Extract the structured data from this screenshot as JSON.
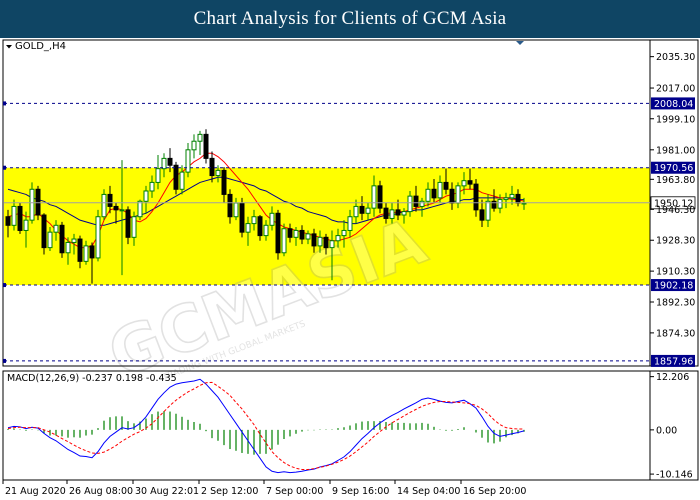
{
  "header": {
    "title": "Chart Analysis for Clients of GCM Asia"
  },
  "chart_data": {
    "type": "candlestick",
    "symbol_label": "GOLD_,H4",
    "watermark": "GCMASIA",
    "watermark_sub": "TRADING WITH GLOBAL MARKETS",
    "y_ticks": [
      "2035.30",
      "2017.00",
      "1999.10",
      "1981.00",
      "1963.80",
      "1946.30",
      "1928.30",
      "1910.30",
      "1892.30",
      "1874.30"
    ],
    "x_ticks": [
      "21 Aug 2020",
      "26 Aug 08:00",
      "30 Aug 22:01",
      "2 Sep 12:00",
      "7 Sep 00:00",
      "9 Sep 16:00",
      "14 Sep 04:00",
      "16 Sep 20:00"
    ],
    "ylim": [
      1855,
      2045
    ],
    "levels": [
      {
        "label": "2008.04",
        "value": 2008.04
      },
      {
        "label": "1970.56",
        "value": 1970.56
      },
      {
        "label": "1902.18",
        "value": 1902.18
      },
      {
        "label": "1857.96",
        "value": 1857.96
      }
    ],
    "current_price": {
      "label": "1950.12",
      "value": 1950.12
    },
    "zone": {
      "upper": 1970.56,
      "lower": 1902.18,
      "color": "#ffff00"
    },
    "colors": {
      "up": "#008000",
      "down": "#000000",
      "ma_fast": "#ff0000",
      "ma_slow": "#00008b",
      "level": "#00008b",
      "macd_line": "#0000ff",
      "macd_signal": "#ff0000",
      "macd_hist": "#008000"
    },
    "ohlc": [
      [
        1942,
        1946,
        1930,
        1937
      ],
      [
        1937,
        1952,
        1934,
        1948
      ],
      [
        1948,
        1950,
        1932,
        1934
      ],
      [
        1934,
        1945,
        1924,
        1940
      ],
      [
        1940,
        1962,
        1938,
        1958
      ],
      [
        1958,
        1960,
        1940,
        1943
      ],
      [
        1943,
        1944,
        1920,
        1924
      ],
      [
        1924,
        1936,
        1922,
        1933
      ],
      [
        1933,
        1940,
        1928,
        1937
      ],
      [
        1937,
        1939,
        1918,
        1921
      ],
      [
        1921,
        1930,
        1914,
        1927
      ],
      [
        1927,
        1932,
        1920,
        1929
      ],
      [
        1929,
        1931,
        1912,
        1916
      ],
      [
        1916,
        1928,
        1914,
        1925
      ],
      [
        1925,
        1927,
        1903,
        1918
      ],
      [
        1918,
        1946,
        1916,
        1942
      ],
      [
        1942,
        1958,
        1940,
        1955
      ],
      [
        1955,
        1960,
        1944,
        1948
      ],
      [
        1948,
        1950,
        1938,
        1946
      ],
      [
        1946,
        1975,
        1908,
        1946
      ],
      [
        1946,
        1948,
        1926,
        1930
      ],
      [
        1930,
        1945,
        1925,
        1942
      ],
      [
        1942,
        1952,
        1940,
        1951
      ],
      [
        1951,
        1960,
        1944,
        1957
      ],
      [
        1957,
        1966,
        1953,
        1962
      ],
      [
        1962,
        1978,
        1958,
        1970
      ],
      [
        1970,
        1979,
        1965,
        1976
      ],
      [
        1976,
        1982,
        1968,
        1972
      ],
      [
        1972,
        1974,
        1955,
        1958
      ],
      [
        1958,
        1972,
        1955,
        1968
      ],
      [
        1968,
        1985,
        1965,
        1981
      ],
      [
        1981,
        1990,
        1976,
        1986
      ],
      [
        1986,
        1992,
        1978,
        1990
      ],
      [
        1990,
        1993,
        1973,
        1976
      ],
      [
        1976,
        1980,
        1962,
        1966
      ],
      [
        1966,
        1972,
        1962,
        1969
      ],
      [
        1969,
        1971,
        1950,
        1955
      ],
      [
        1955,
        1958,
        1938,
        1942
      ],
      [
        1942,
        1953,
        1940,
        1950
      ],
      [
        1950,
        1953,
        1930,
        1933
      ],
      [
        1933,
        1942,
        1925,
        1938
      ],
      [
        1938,
        1946,
        1934,
        1942
      ],
      [
        1942,
        1943,
        1928,
        1931
      ],
      [
        1931,
        1940,
        1928,
        1937
      ],
      [
        1937,
        1948,
        1934,
        1944
      ],
      [
        1944,
        1946,
        1917,
        1921
      ],
      [
        1921,
        1938,
        1919,
        1935
      ],
      [
        1935,
        1938,
        1927,
        1930
      ],
      [
        1930,
        1936,
        1925,
        1934
      ],
      [
        1934,
        1937,
        1926,
        1929
      ],
      [
        1929,
        1934,
        1926,
        1932
      ],
      [
        1932,
        1935,
        1921,
        1925
      ],
      [
        1925,
        1934,
        1921,
        1930
      ],
      [
        1930,
        1932,
        1920,
        1924
      ],
      [
        1924,
        1934,
        1905,
        1928
      ],
      [
        1928,
        1935,
        1924,
        1931
      ],
      [
        1931,
        1940,
        1924,
        1934
      ],
      [
        1934,
        1946,
        1930,
        1942
      ],
      [
        1942,
        1952,
        1938,
        1948
      ],
      [
        1948,
        1954,
        1940,
        1944
      ],
      [
        1944,
        1950,
        1940,
        1947
      ],
      [
        1947,
        1966,
        1942,
        1960
      ],
      [
        1960,
        1963,
        1944,
        1947
      ],
      [
        1947,
        1950,
        1938,
        1941
      ],
      [
        1941,
        1950,
        1938,
        1946
      ],
      [
        1946,
        1952,
        1940,
        1943
      ],
      [
        1943,
        1947,
        1938,
        1945
      ],
      [
        1945,
        1957,
        1942,
        1954
      ],
      [
        1954,
        1960,
        1945,
        1948
      ],
      [
        1948,
        1953,
        1942,
        1951
      ],
      [
        1951,
        1962,
        1948,
        1958
      ],
      [
        1958,
        1964,
        1950,
        1953
      ],
      [
        1953,
        1966,
        1950,
        1962
      ],
      [
        1962,
        1970,
        1955,
        1958
      ],
      [
        1958,
        1962,
        1946,
        1950
      ],
      [
        1950,
        1962,
        1947,
        1960
      ],
      [
        1960,
        1968,
        1955,
        1963
      ],
      [
        1963,
        1970,
        1958,
        1961
      ],
      [
        1961,
        1964,
        1942,
        1946
      ],
      [
        1946,
        1952,
        1936,
        1940
      ],
      [
        1940,
        1955,
        1936,
        1951
      ],
      [
        1951,
        1958,
        1945,
        1947
      ],
      [
        1947,
        1955,
        1944,
        1952
      ],
      [
        1952,
        1956,
        1947,
        1953
      ],
      [
        1953,
        1960,
        1949,
        1955
      ],
      [
        1955,
        1958,
        1948,
        1950
      ],
      [
        1950,
        1953,
        1946,
        1950
      ]
    ],
    "ma_fast": [
      1942,
      1943,
      1944,
      1942,
      1942,
      1944,
      1941,
      1938,
      1934,
      1931,
      1928,
      1926,
      1924,
      1924,
      1925,
      1931,
      1940,
      1946,
      1947,
      1946,
      1944,
      1940,
      1939,
      1941,
      1945,
      1950,
      1956,
      1962,
      1966,
      1968,
      1971,
      1974,
      1976,
      1979,
      1979,
      1977,
      1974,
      1970,
      1966,
      1962,
      1958,
      1953,
      1948,
      1943,
      1940,
      1938,
      1936,
      1935,
      1934,
      1933,
      1932,
      1931,
      1930,
      1929,
      1928,
      1928,
      1929,
      1930,
      1932,
      1935,
      1938,
      1941,
      1943,
      1944,
      1944,
      1945,
      1945,
      1946,
      1947,
      1948,
      1949,
      1950,
      1952,
      1954,
      1955,
      1956,
      1958,
      1958,
      1958,
      1956,
      1955,
      1954,
      1953,
      1953,
      1952,
      1952,
      1951
    ],
    "ma_slow": [
      1958,
      1957,
      1956,
      1955,
      1953,
      1952,
      1951,
      1949,
      1948,
      1946,
      1944,
      1942,
      1940,
      1939,
      1938,
      1937,
      1937,
      1938,
      1939,
      1940,
      1941,
      1942,
      1943,
      1944,
      1946,
      1948,
      1950,
      1952,
      1954,
      1956,
      1958,
      1960,
      1962,
      1963,
      1964,
      1965,
      1965,
      1964,
      1963,
      1962,
      1961,
      1960,
      1958,
      1957,
      1955,
      1953,
      1951,
      1950,
      1948,
      1947,
      1945,
      1944,
      1943,
      1942,
      1940,
      1939,
      1939,
      1938,
      1938,
      1939,
      1940,
      1941,
      1942,
      1943,
      1943,
      1944,
      1945,
      1945,
      1946,
      1946,
      1947,
      1948,
      1949,
      1950,
      1951,
      1951,
      1952,
      1952,
      1953,
      1953,
      1953,
      1953,
      1953,
      1953,
      1953,
      1952,
      1952
    ],
    "macd": {
      "label": "MACD(12,26,9) -0.237 0.198 -0.435",
      "y_ticks": [
        "12.206",
        "0.00",
        "-10.146"
      ],
      "ylim": [
        -11.5,
        13.5
      ],
      "main": [
        0.5,
        0.8,
        0.7,
        0.3,
        0.6,
        0.4,
        -0.8,
        -1.8,
        -2.5,
        -3.5,
        -4.5,
        -5.2,
        -6.0,
        -6.1,
        -6.4,
        -5.0,
        -3.0,
        -1.5,
        -0.5,
        0.5,
        0.2,
        0.5,
        1.5,
        3.0,
        5.0,
        7.0,
        8.5,
        9.8,
        10.5,
        10.8,
        11.0,
        11.2,
        11.6,
        10.5,
        9.0,
        7.5,
        5.5,
        3.5,
        1.5,
        -0.5,
        -2.5,
        -4.5,
        -6.5,
        -8.5,
        -9.5,
        -9.8,
        -9.6,
        -9.8,
        -9.7,
        -9.5,
        -9.2,
        -9.0,
        -8.5,
        -8.2,
        -7.8,
        -7.0,
        -6.2,
        -5.0,
        -3.5,
        -2.0,
        -0.8,
        0.5,
        1.6,
        2.5,
        3.3,
        4.0,
        4.8,
        5.5,
        6.2,
        7.0,
        7.3,
        7.0,
        6.6,
        6.3,
        6.2,
        6.5,
        6.8,
        6.0,
        5.0,
        3.0,
        0.8,
        -0.8,
        -1.5,
        -1.2,
        -0.9,
        -0.6,
        -0.237
      ],
      "signal": [
        0.3,
        0.5,
        0.6,
        0.5,
        0.5,
        0.5,
        0.0,
        -0.5,
        -1.2,
        -2.0,
        -2.7,
        -3.5,
        -4.2,
        -4.8,
        -5.3,
        -5.4,
        -5.1,
        -4.4,
        -3.6,
        -2.6,
        -1.8,
        -1.0,
        -0.4,
        0.4,
        1.4,
        2.8,
        4.2,
        5.6,
        6.8,
        7.8,
        8.7,
        9.4,
        10.2,
        10.8,
        10.9,
        10.0,
        9.0,
        7.9,
        6.3,
        4.8,
        3.0,
        1.2,
        -1.0,
        -3.0,
        -5.0,
        -6.4,
        -7.5,
        -8.3,
        -8.8,
        -9.1,
        -9.1,
        -8.9,
        -8.6,
        -8.3,
        -7.9,
        -7.4,
        -6.8,
        -6.0,
        -5.0,
        -3.9,
        -2.8,
        -1.5,
        -0.4,
        0.7,
        1.6,
        2.4,
        3.2,
        4.0,
        4.7,
        5.4,
        5.9,
        6.3,
        6.5,
        6.5,
        6.4,
        6.3,
        6.2,
        6.0,
        5.6,
        4.8,
        3.7,
        2.3,
        1.2,
        0.5,
        0.3,
        0.2,
        0.198
      ]
    }
  }
}
